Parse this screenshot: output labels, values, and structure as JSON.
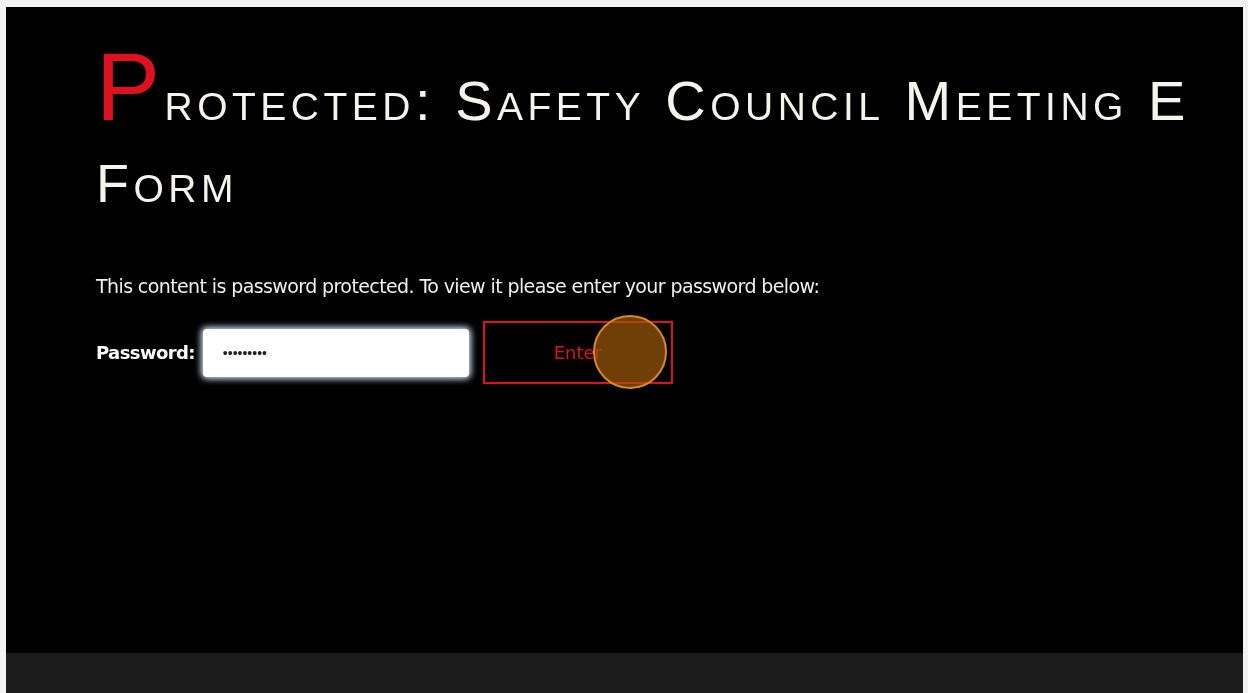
{
  "title_lines": [
    "Protected: Safety Council Meeting E",
    "Form"
  ],
  "notice": "This content is password protected. To view it please enter your password below:",
  "password_field": {
    "label": "Password:",
    "value": "•••••••••",
    "focused": true
  },
  "submit_button": {
    "label": "Enter"
  }
}
